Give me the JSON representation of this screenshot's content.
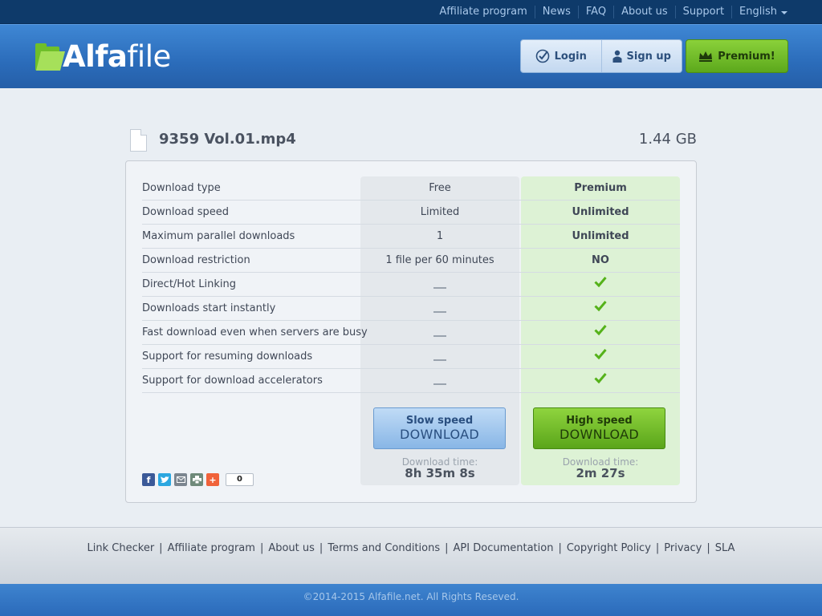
{
  "topnav": {
    "links": [
      "Affiliate program",
      "News",
      "FAQ",
      "About us",
      "Support"
    ],
    "language": "English"
  },
  "header": {
    "logo_bold": "Alfa",
    "logo_light": "file",
    "login": "Login",
    "signup": "Sign up",
    "premium": "Premium!"
  },
  "file": {
    "name": "9359 Vol.01.mp4",
    "size": "1.44 GB"
  },
  "table": {
    "rows": [
      {
        "label": "Download type",
        "free": "Free",
        "premium": "Premium"
      },
      {
        "label": "Download speed",
        "free": "Limited",
        "premium": "Unlimited"
      },
      {
        "label": "Maximum parallel downloads",
        "free": "1",
        "premium": "Unlimited"
      },
      {
        "label": "Download restriction",
        "free": "1 file per 60 minutes",
        "premium": "NO"
      },
      {
        "label": "Direct/Hot Linking",
        "free": "dash",
        "premium": "check"
      },
      {
        "label": "Downloads start instantly",
        "free": "dash",
        "premium": "check"
      },
      {
        "label": "Fast download even when servers are busy",
        "free": "dash",
        "premium": "check"
      },
      {
        "label": "Support for resuming downloads",
        "free": "dash",
        "premium": "check"
      },
      {
        "label": "Support for download accelerators",
        "free": "dash",
        "premium": "check"
      }
    ]
  },
  "download": {
    "slow": {
      "line1": "Slow speed",
      "line2": "DOWNLOAD",
      "time_label": "Download time:",
      "time": "8h 35m 8s"
    },
    "fast": {
      "line1": "High speed",
      "line2": "DOWNLOAD",
      "time_label": "Download time:",
      "time": "2m 27s"
    }
  },
  "share": {
    "icons": [
      "facebook-icon",
      "twitter-icon",
      "email-icon",
      "print-icon",
      "addthis-icon"
    ],
    "count": "0"
  },
  "footer": {
    "links": [
      "Link Checker",
      "Affiliate program",
      "About us",
      "Terms and Conditions",
      "API Documentation",
      "Copyright Policy",
      "Privacy",
      "SLA"
    ],
    "copyright": "©2014-2015 Alfafile.net. All Rights Reseved."
  },
  "colors": {
    "accent_blue": "#2b6cba",
    "premium_green": "#5ca81c",
    "check_green": "#55b21a"
  }
}
